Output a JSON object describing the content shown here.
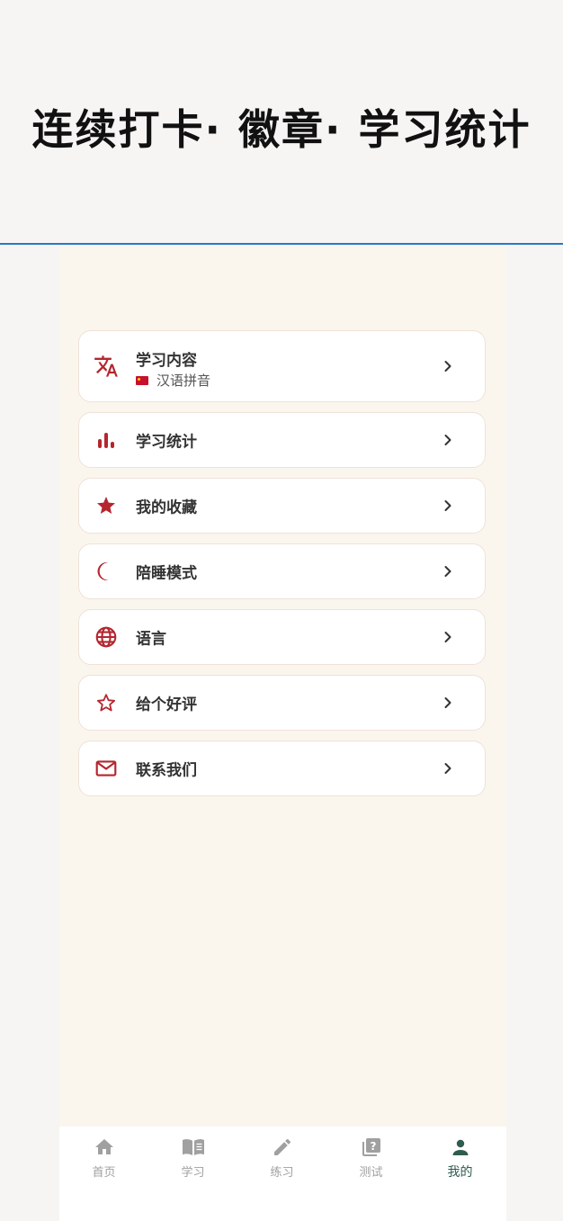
{
  "banner": {
    "title": "连续打卡· 徽章· 学习统计"
  },
  "menu": {
    "items": [
      {
        "label": "学习内容",
        "sub_label": "汉语拼音",
        "icon": "translate-icon"
      },
      {
        "label": "学习统计",
        "icon": "bar-chart-icon"
      },
      {
        "label": "我的收藏",
        "icon": "star-filled-icon"
      },
      {
        "label": "陪睡模式",
        "icon": "moon-icon"
      },
      {
        "label": "语言",
        "icon": "globe-icon"
      },
      {
        "label": "给个好评",
        "icon": "star-outline-icon"
      },
      {
        "label": "联系我们",
        "icon": "mail-icon"
      }
    ]
  },
  "tabs": {
    "items": [
      {
        "label": "首页",
        "icon": "home-icon"
      },
      {
        "label": "学习",
        "icon": "book-icon"
      },
      {
        "label": "练习",
        "icon": "pencil-icon"
      },
      {
        "label": "测试",
        "icon": "quiz-icon"
      },
      {
        "label": "我的",
        "icon": "person-icon"
      }
    ],
    "active_index": 4
  },
  "colors": {
    "accent": "#b5262e",
    "active_tab": "#2f5c4f",
    "banner_rule": "#2a78c8"
  }
}
